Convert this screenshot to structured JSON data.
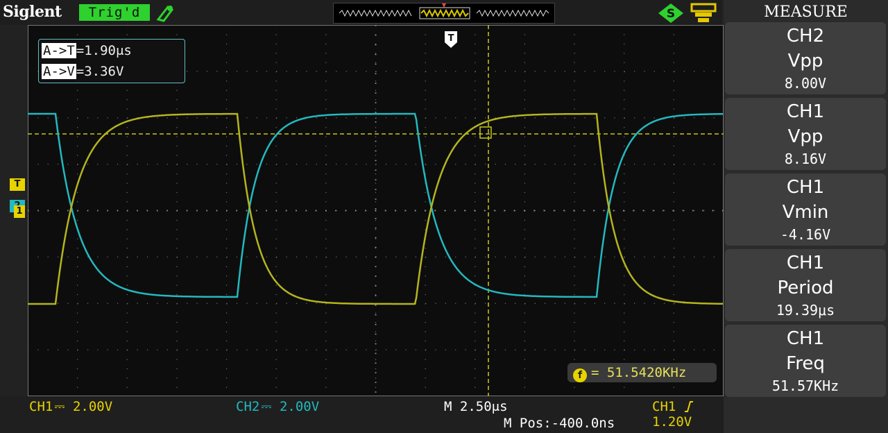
{
  "header": {
    "brand": "Siglent",
    "trigger_status": "Trig'd",
    "trigger_status_color": "#2ed12e",
    "icons": [
      "trigger-probe-icon",
      "memory-window-icon",
      "s-badge-icon",
      "usb-device-icon"
    ]
  },
  "colors": {
    "ch1": "#b4b41e",
    "ch2": "#23b9bf",
    "cursor": "#c8c81e",
    "grid_dot": "#707070"
  },
  "cursors": {
    "time_label": "A->T",
    "time_value": "=1.90μs",
    "volt_label": "A->V",
    "volt_value": "=3.36V"
  },
  "frequency_counter": {
    "icon": "f",
    "value": "= 51.5420KHz"
  },
  "markers": {
    "trigger_level": "T",
    "ch2_level": "2",
    "ch1_level": "1",
    "trigger_position": "T"
  },
  "status_bar": {
    "ch1": "CH1 2.00V",
    "ch1_coupling_symbol": "⎓",
    "ch2": "CH2 2.00V",
    "ch2_coupling_symbol": "⎓",
    "timebase": "M 2.50μs",
    "trigger": "CH1 /1.20V",
    "position": "M Pos:-400.0ns"
  },
  "measure_panel": {
    "title": "MEASURE",
    "items": [
      {
        "channel": "CH2",
        "name": "Vpp",
        "value": "8.00V"
      },
      {
        "channel": "CH1",
        "name": "Vpp",
        "value": "8.16V"
      },
      {
        "channel": "CH1",
        "name": "Vmin",
        "value": "-4.16V"
      },
      {
        "channel": "CH1",
        "name": "Period",
        "value": "19.39μs"
      },
      {
        "channel": "CH1",
        "name": "Freq",
        "value": "51.57KHz"
      }
    ]
  }
}
